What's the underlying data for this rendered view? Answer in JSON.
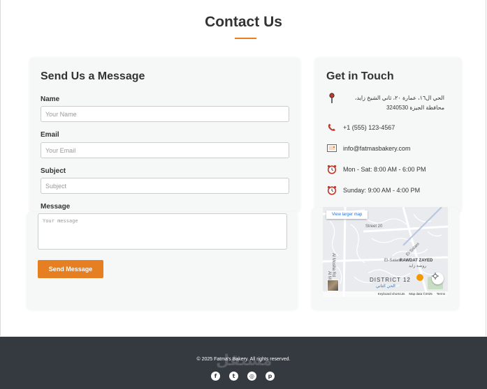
{
  "page": {
    "title": "Contact Us",
    "accent_color": "#e67e22"
  },
  "form": {
    "title": "Send Us a Message",
    "name_label": "Name",
    "name_placeholder": "Your Name",
    "email_label": "Email",
    "email_placeholder": "Your Email",
    "subject_label": "Subject",
    "subject_placeholder": "Subject",
    "message_label": "Message",
    "message_placeholder": "Your message",
    "submit_label": "Send Message"
  },
  "contact": {
    "title": "Get in Touch",
    "items": [
      {
        "icon": "location-pin-icon",
        "text": "الحي ال١٦، عمارة ٢٠، ثاني الشيخ زايد، محافظة الجيزة 3240530"
      },
      {
        "icon": "phone-icon",
        "text": "+1 (555) 123-4567"
      },
      {
        "icon": "email-icon",
        "text": "info@fatmasbakery.com"
      },
      {
        "icon": "alarm-clock-icon",
        "text": "Mon - Sat: 8:00 AM - 6:00 PM"
      },
      {
        "icon": "alarm-clock-icon",
        "text": "Sunday: 9:00 AM - 4:00 PM"
      }
    ]
  },
  "map": {
    "view_larger_label": "View larger map",
    "labels": {
      "street20": "Street 20",
      "elsalam_road": "El-Salam",
      "elsalam": "El-Salam",
      "rawdat_zayed": "RAWDAT ZAYED",
      "rawdat_zayed_ar": "روضة زايد",
      "al_mosh_rd": "Al Mosha Rd",
      "al_mosh": "Al Mosh",
      "district": "DISTRICT 12",
      "district_ar": "الحي الثاني"
    },
    "footer": {
      "shortcuts": "Keyboard shortcuts",
      "mapdata": "Map data ©2025",
      "terms": "Terms"
    }
  },
  "footer": {
    "copyright": "© 2025 Fatma's Bakery. All rights reserved.",
    "watermark": "مستقل",
    "social": [
      {
        "icon": "facebook-icon",
        "glyph": "f"
      },
      {
        "icon": "twitter-icon",
        "glyph": "t"
      },
      {
        "icon": "instagram-icon",
        "glyph": "◎"
      },
      {
        "icon": "pinterest-icon",
        "glyph": "p"
      }
    ]
  }
}
